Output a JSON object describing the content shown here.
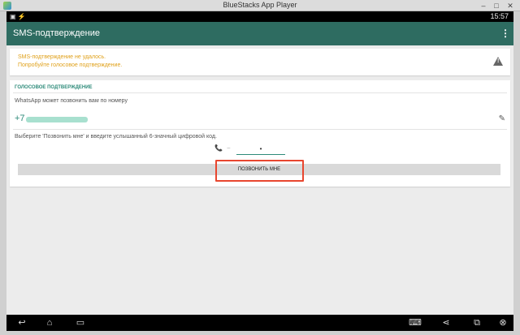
{
  "window": {
    "title": "BlueStacks App Player",
    "min": "–",
    "max": "□",
    "close": "✕"
  },
  "status": {
    "time": "15:57",
    "left_icons": "▣ ⚡"
  },
  "appbar": {
    "title": "SMS-подтверждение",
    "menu": "⋮"
  },
  "warning": {
    "line1": "SMS-подтверждение не удалось.",
    "line2": "Попробуйте голосовое подтверждение."
  },
  "voice": {
    "heading": "ГОЛОСОВОЕ ПОДТВЕРЖДЕНИЕ",
    "description": "WhatsApp может позвонить вам по номеру",
    "phone_prefix": "+7",
    "instruction": "Выберите 'Позвонить мне' и введите услышанный 6-значный цифровой код.",
    "code_value": "•",
    "call_button": "ПОЗВОНИТЬ МНЕ"
  },
  "icons": {
    "phone": "📞",
    "dash": "−",
    "edit": "✎",
    "back": "↩",
    "home": "⌂",
    "recent": "▭",
    "keyboard": "⌨",
    "share": "⋖",
    "screen": "⧉",
    "exit": "⊗"
  },
  "colors": {
    "accent": "#2e6c61",
    "teal": "#2e8b7a",
    "warning": "#e0a11b",
    "highlight": "#e8462f"
  }
}
